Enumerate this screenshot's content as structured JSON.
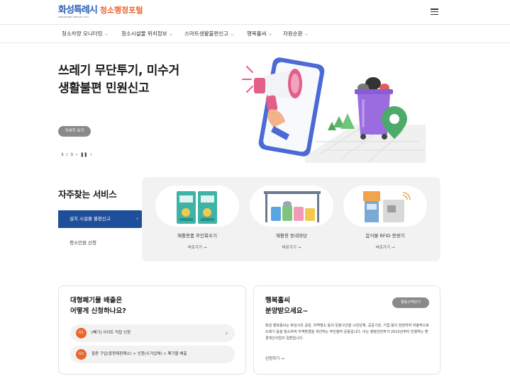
{
  "header": {
    "logo_mark": "화성특례시",
    "logo_sub": "HWASEONG SPECIAL CITY",
    "logo_title": "청소행정포털"
  },
  "nav": {
    "items": [
      {
        "label": "청소차량 모니터링"
      },
      {
        "label": "청소시설물 위치정보"
      },
      {
        "label": "스마트생활불편신고"
      },
      {
        "label": "행복홀씨"
      },
      {
        "label": "자원순환"
      }
    ]
  },
  "hero": {
    "title_line1": "쓰레기 무단투기, 미수거",
    "title_line2": "생활불편 민원신고",
    "more_label": "자세히 보기",
    "pager_current": "3",
    "pager_sep": "/",
    "pager_total": "3"
  },
  "services": {
    "title": "자주찾는 서비스",
    "tabs": [
      {
        "label": "설치 시설물 불편신고",
        "active": true
      },
      {
        "label": "청소민원 신청",
        "active": false
      }
    ],
    "cards": [
      {
        "name": "재활용품 무인회수기",
        "link": "바로가기"
      },
      {
        "name": "재활용 동네마당",
        "link": "바로가기"
      },
      {
        "name": "음식물 RFID 종량기",
        "link": "바로가기"
      }
    ]
  },
  "bulky": {
    "title_line1": "대형폐기물 배출은",
    "title_line2": "어떻게 신청하나요?",
    "steps": [
      {
        "num": "01",
        "text": "[빼기] 사이트 직접 신청"
      },
      {
        "num": "02",
        "text": "필증 구입(중량제판매소) > 신청(수거업체) > 폐기물 배출"
      }
    ]
  },
  "hope": {
    "title_line1": "행복홀씨",
    "title_line2": "분양받으세요~",
    "badge": "활동구역보기",
    "desc": "화성 행복홀씨는 화성시의 공원, 지역명소 등의 일정구간을 시민단체, 공공기관, 기업 등이 담당하여 자율적으로 쓰레기 등을 청소하여 지역환경을 개선하는 주민참여 운동입니다. 이는 행정안전부가 2015년부터 진행하는 환경개선사업의 일환입니다.",
    "link": "신청하기"
  },
  "colors": {
    "brand_blue": "#1f4f9a",
    "accent_orange": "#e9662c",
    "panel_gray": "#f2f2f2",
    "badge_gray": "#8a8a8a"
  }
}
